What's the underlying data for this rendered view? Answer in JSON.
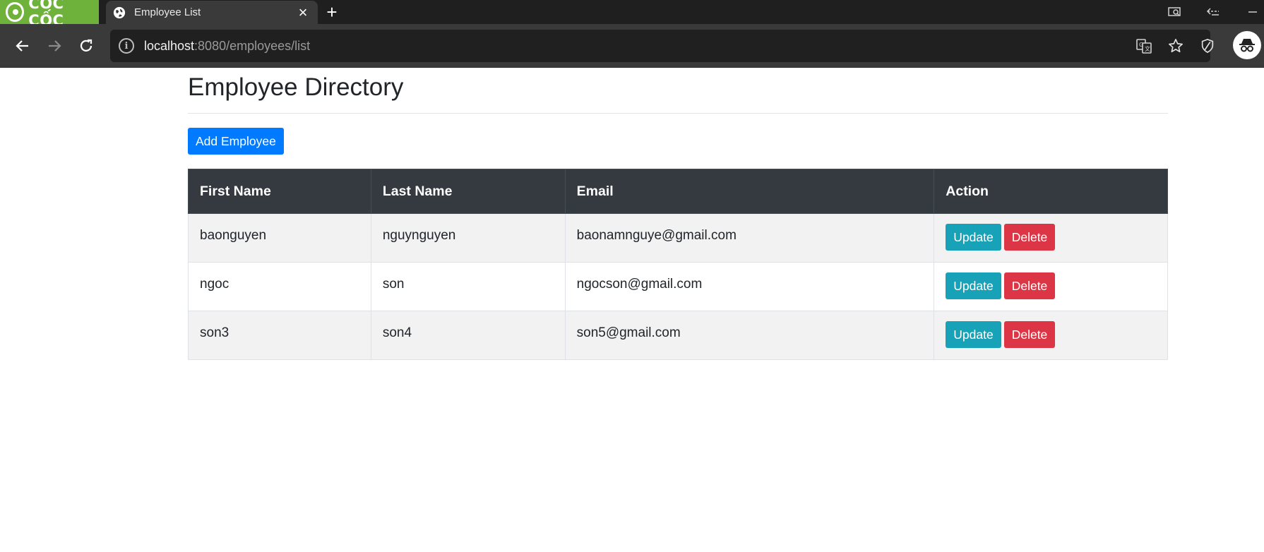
{
  "browser": {
    "brand_name": "CỐC CỐC",
    "tab_title": "Employee List",
    "url_host": "localhost",
    "url_rest": ":8080/employees/list"
  },
  "page": {
    "title": "Employee Directory",
    "add_button_label": "Add Employee"
  },
  "table": {
    "headers": [
      "First Name",
      "Last Name",
      "Email",
      "Action"
    ],
    "update_label": "Update",
    "delete_label": "Delete",
    "rows": [
      {
        "first_name": "baonguyen",
        "last_name": "nguynguyen",
        "email": "baonamnguye@gmail.com"
      },
      {
        "first_name": "ngoc",
        "last_name": "son",
        "email": "ngocson@gmail.com"
      },
      {
        "first_name": "son3",
        "last_name": "son4",
        "email": "son5@gmail.com"
      }
    ]
  },
  "colors": {
    "primary": "#007bff",
    "info": "#17a2b8",
    "danger": "#dc3545",
    "table_header": "#343a40"
  }
}
